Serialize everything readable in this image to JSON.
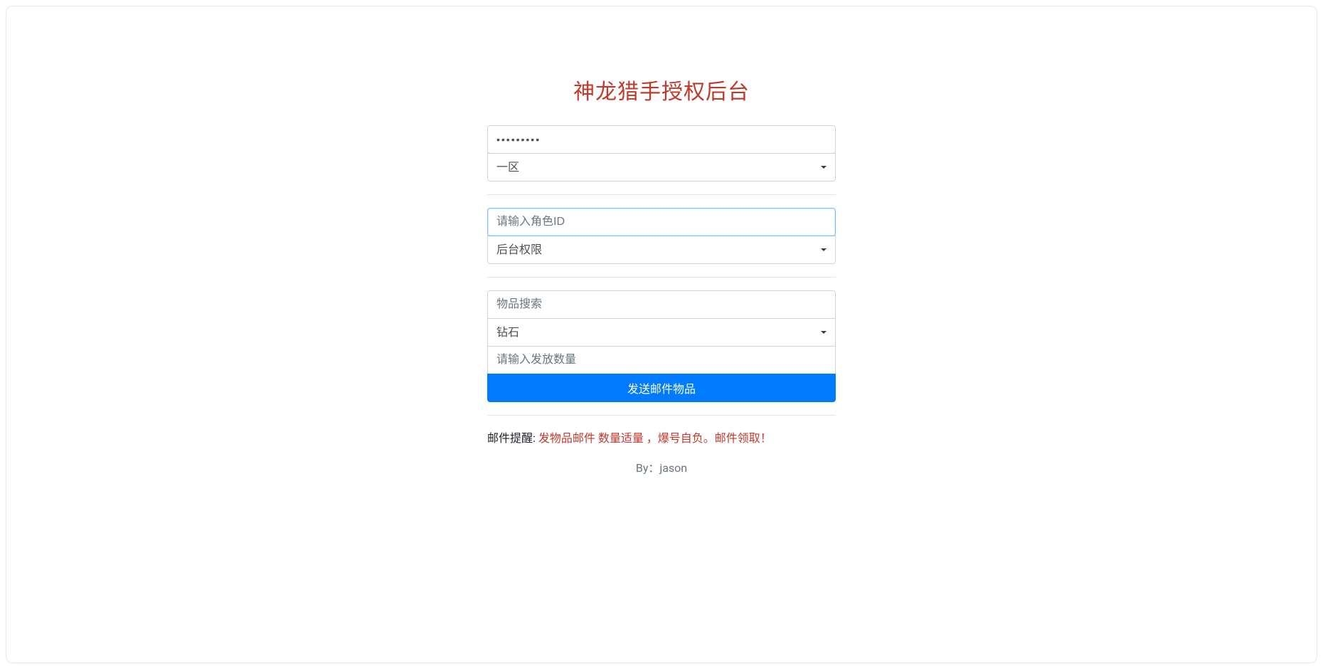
{
  "title": "神龙猎手授权后台",
  "auth": {
    "password_value": "•••••••••",
    "zone_selected": "一区"
  },
  "permission": {
    "role_id_placeholder": "请输入角色ID",
    "role_id_value": "",
    "permission_selected": "后台权限"
  },
  "mail": {
    "search_placeholder": "物品搜索",
    "search_value": "",
    "item_selected": "钻石",
    "quantity_placeholder": "请输入发放数量",
    "quantity_value": "",
    "send_button": "发送邮件物品"
  },
  "notice": {
    "label": "邮件提醒: ",
    "text": "发物品邮件 数量适量 ，爆号自负。邮件领取！"
  },
  "footer": "By：jason"
}
